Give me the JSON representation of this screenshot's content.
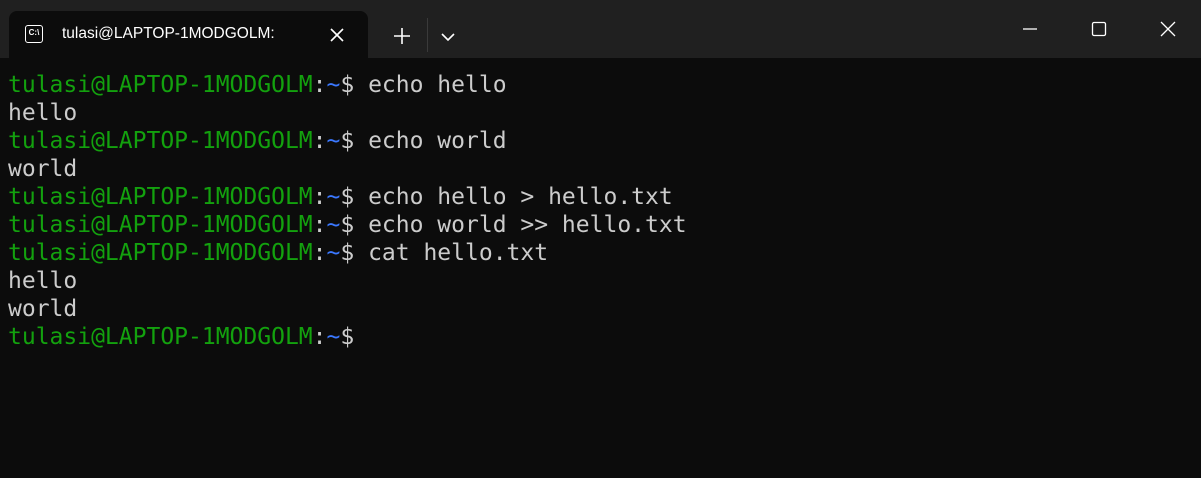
{
  "tab": {
    "title": "tulasi@LAPTOP-1MODGOLM:",
    "icon": "terminal-icon",
    "icon_text": "C:\\"
  },
  "titlebar": {
    "new_tab_icon": "plus-icon",
    "dropdown_icon": "chevron-down-icon",
    "minimize_icon": "minimize-icon",
    "maximize_icon": "maximize-icon",
    "close_icon": "close-icon"
  },
  "colors": {
    "background": "#0c0c0c",
    "titlebar": "#202020",
    "prompt_user": "#13a10e",
    "prompt_path": "#3b78ff",
    "text": "#cccccc"
  },
  "terminal": {
    "prompt": {
      "user_host": "tulasi@LAPTOP-1MODGOLM",
      "colon": ":",
      "path": "~",
      "symbol": "$"
    },
    "lines": [
      {
        "type": "command",
        "text": " echo hello"
      },
      {
        "type": "output",
        "text": "hello"
      },
      {
        "type": "command",
        "text": " echo world"
      },
      {
        "type": "output",
        "text": "world"
      },
      {
        "type": "command",
        "text": " echo hello > hello.txt"
      },
      {
        "type": "command",
        "text": " echo world >> hello.txt"
      },
      {
        "type": "command",
        "text": " cat hello.txt"
      },
      {
        "type": "output",
        "text": "hello"
      },
      {
        "type": "output",
        "text": "world"
      },
      {
        "type": "command",
        "text": ""
      }
    ]
  }
}
